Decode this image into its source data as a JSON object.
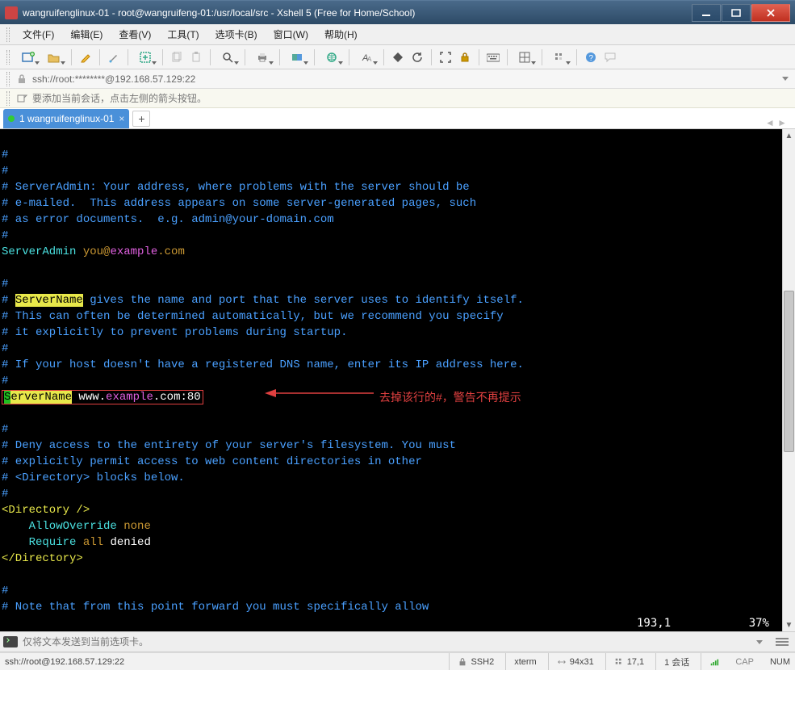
{
  "window": {
    "title": "wangruifenglinux-01 - root@wangruifeng-01:/usr/local/src - Xshell 5 (Free for Home/School)"
  },
  "menu": {
    "file": "文件(F)",
    "edit": "编辑(E)",
    "view": "查看(V)",
    "tools": "工具(T)",
    "tabs": "选项卡(B)",
    "window": "窗口(W)",
    "help": "帮助(H)"
  },
  "addressbar": {
    "value": "ssh://root:********@192.168.57.129:22"
  },
  "infobar": {
    "text": "要添加当前会话，点击左侧的箭头按钮。"
  },
  "tab": {
    "label": "1 wangruifenglinux-01",
    "close": "×",
    "new": "+",
    "nav": "◄  ►"
  },
  "terminal": {
    "pos": "193,1",
    "pct": "37%",
    "lines": {
      "l1": "#",
      "l2": "#",
      "l3a": "# ServerAdmin: Your address, where problems with the server should be",
      "l3b": "# e-mailed.  This address appears on some server-generated pages, such",
      "l3c": "# as error documents.  e.g. admin@your-domain.com",
      "l3d": "#",
      "l4a": "ServerAdmin",
      "l4b": " you@",
      "l4c": "example",
      "l4d": ".com",
      "l5a": "#",
      "l5b": "# ",
      "l5sn": "ServerName",
      "l5c": " gives the name and port that the server uses to identify itself.",
      "l5d": "# This can often be determined automatically, but we recommend you specify",
      "l5e": "# it explicitly to prevent problems during startup.",
      "l5f": "#",
      "l5g": "# If your host doesn't have a registered DNS name, enter its IP address here.",
      "l5h": "#",
      "l6s": "S",
      "l6r": "erverName",
      "l6w": " www.",
      "l6e": "example",
      "l6p": ".com:80",
      "l7a": "#",
      "l7b": "# Deny access to the entirety of your server's filesystem. You must",
      "l7c": "# explicitly permit access to web content directories in other",
      "l7d": "# <Directory> blocks below.",
      "l7e": "#",
      "l8a": "<Directory />",
      "l8b": "    AllowOverride ",
      "l8bn": "none",
      "l8c": "    Require ",
      "l8ca": "all",
      "l8cd": " denied",
      "l8d": "</Directory>",
      "l9a": "#",
      "l9b": "# Note that from this point forward you must specifically allow"
    },
    "annotation": "去掉该行的#，警告不再提示"
  },
  "inputbar": {
    "placeholder": "仅将文本发送到当前选项卡。"
  },
  "status": {
    "conn": "ssh://root@192.168.57.129:22",
    "proto": "SSH2",
    "term": "xterm",
    "size": "94x31",
    "rownum": "17,1",
    "sess": "1 会话",
    "cap": "CAP",
    "num": "NUM"
  }
}
